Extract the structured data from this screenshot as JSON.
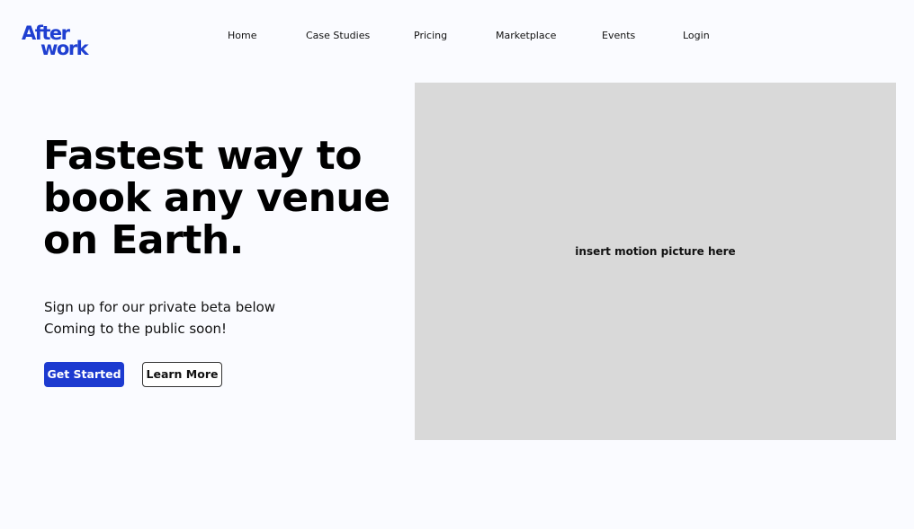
{
  "brand": {
    "logo_line1": "After",
    "logo_line2": "work",
    "color": "#1f3fd1"
  },
  "nav": {
    "items": [
      "Home",
      "Case Studies",
      "Pricing",
      "Marketplace",
      "Events",
      "Login"
    ]
  },
  "hero": {
    "headline": "Fastest way to book any venue on Earth.",
    "subtext_line1": "Sign up for our private beta below",
    "subtext_line2": "Coming to the public soon!",
    "primary_button": "Get Started",
    "secondary_button": "Learn More",
    "primary_color": "#1c3ad0"
  },
  "media": {
    "placeholder_text": "insert motion picture here",
    "background": "#d9d9d9"
  }
}
